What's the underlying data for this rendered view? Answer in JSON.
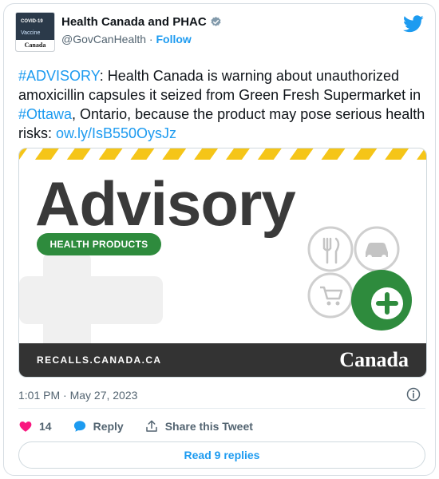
{
  "account": {
    "display_name": "Health Canada and PHAC",
    "handle": "@GovCanHealth",
    "separator": " · ",
    "follow_label": "Follow",
    "avatar": {
      "line1": "COVID-19",
      "line2": "Vaccine",
      "wordmark": "Canada"
    }
  },
  "tweet": {
    "hashtag1": "#ADVISORY",
    "text1": ": Health Canada is warning about unauthorized amoxicillin capsules it seized from Green Fresh Supermarket in ",
    "hashtag2": "#Ottawa",
    "text2": ", Ontario, because the product may pose serious health risks:  ",
    "link": "ow.ly/IsB550OysJz"
  },
  "media": {
    "title": "Advisory",
    "pill": "HEALTH PRODUCTS",
    "footer_url": "RECALLS.CANADA.CA",
    "wordmark": "Canada"
  },
  "meta": {
    "timestamp": "1:01 PM · May 27, 2023"
  },
  "actions": {
    "like_count": "14",
    "reply_label": "Reply",
    "share_label": "Share this Tweet"
  },
  "read_replies_label": "Read 9 replies",
  "colors": {
    "twitter_blue": "#1d9bf0",
    "like_pink": "#f91880",
    "health_green": "#2e8b3d",
    "hazard_yellow": "#f5c518",
    "footer_dark": "#333333"
  },
  "icons": {
    "verified": "verified-badge-icon",
    "brand": "twitter-bird-icon",
    "info": "info-icon",
    "like": "heart-icon",
    "reply": "reply-bubble-icon",
    "share": "share-upload-icon"
  }
}
